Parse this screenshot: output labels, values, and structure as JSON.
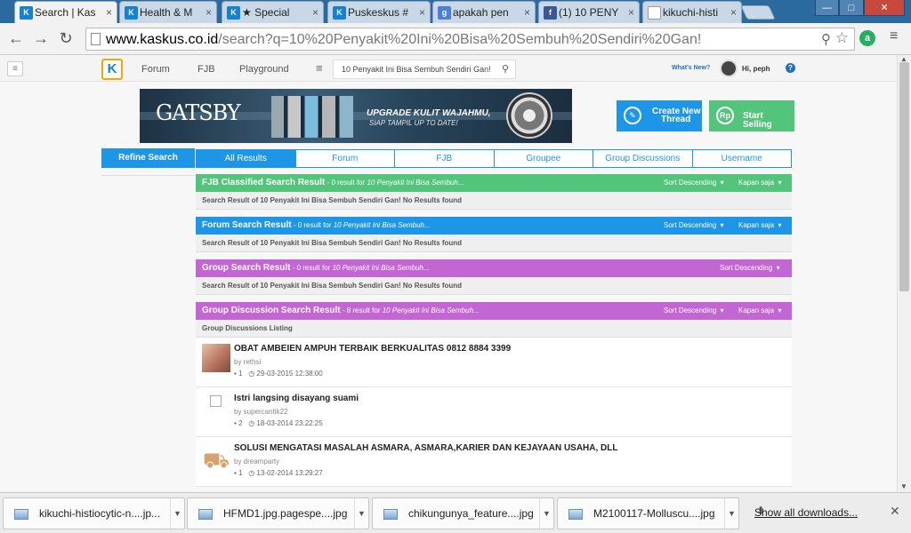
{
  "browser": {
    "tabs": [
      {
        "title": "Search | Kas",
        "favicon": "kaskus-favicon",
        "color": "#1482d0",
        "glyph": "K",
        "active": true
      },
      {
        "title": "Health & M",
        "favicon": "kaskus-favicon",
        "color": "#1482d0",
        "glyph": "K",
        "active": false
      },
      {
        "title": "★ Special",
        "favicon": "kaskus-favicon",
        "color": "#1482d0",
        "glyph": "K",
        "active": false
      },
      {
        "title": "Puskeskus #",
        "favicon": "kaskus-favicon",
        "color": "#1482d0",
        "glyph": "K",
        "active": false
      },
      {
        "title": "apakah pen",
        "favicon": "google-favicon",
        "color": "#4a7fe0",
        "glyph": "g",
        "active": false
      },
      {
        "title": "(1) 10 PENY",
        "favicon": "facebook-favicon",
        "color": "#3b5998",
        "glyph": "f",
        "active": false
      },
      {
        "title": "kikuchi-histi",
        "favicon": "page-favicon",
        "color": "#ffffff",
        "glyph": "",
        "active": false
      }
    ],
    "url_host": "www.kaskus.co.id",
    "url_path": "/search?q=10%20Penyakit%20Ini%20Bisa%20Sembuh%20Sendiri%20Gan!"
  },
  "header": {
    "logo": "K",
    "nav": [
      "Forum",
      "FJB",
      "Playground"
    ],
    "search_value": "10 Penyakit Ini Bisa Sembuh Sendiri Gan!",
    "whats_new": "What's New?",
    "greeting": "Hi, peph",
    "help": "?"
  },
  "banner": {
    "brand": "GATSBY",
    "tagline_1": "UPGRADE KULIT WAJAHMU,",
    "tagline_2": "SIAP TAMPIL UP TO DATE!"
  },
  "actions": {
    "create_thread": [
      "Create New",
      "Thread"
    ],
    "start_selling": "Start Selling"
  },
  "refine": "Refine Search",
  "search_tabs": [
    "All Results",
    "Forum",
    "FJB",
    "Groupee",
    "Group Discussions",
    "Username"
  ],
  "sections": {
    "fjb": {
      "title": "FJB Classified Search Result",
      "count": " - 0 result for ",
      "query": "10 Penyakit Ini Bisa Sembuh...",
      "sort": "Sort Descending",
      "time": "Kapan saja",
      "body": "Search Result of 10 Penyakit Ini Bisa Sembuh Sendiri Gan! No Results found",
      "color": "#52c57b"
    },
    "forum": {
      "title": "Forum Search Result",
      "count": " - 0 result for ",
      "query": "10 Penyakit Ini Bisa Sembuh...",
      "sort": "Sort Descending",
      "time": "Kapan saja",
      "body": "Search Result of 10 Penyakit Ini Bisa Sembuh Sendiri Gan! No Results found",
      "color": "#1e96e8"
    },
    "group": {
      "title": "Group Search Result",
      "count": " - 0 result for ",
      "query": "10 Penyakit Ini Bisa Sembuh...",
      "sort": "Sort Descending",
      "body": "Search Result of 10 Penyakit Ini Bisa Sembuh Sendiri Gan! No Results found",
      "color": "#c266d3"
    },
    "discussion": {
      "title": "Group Discussion Search Result",
      "count": " - 8 result for ",
      "query": "10 Penyakit Ini Bisa Sembuh...",
      "sort": "Sort Descending",
      "time": "Kapan saja",
      "listing": "Group Discussions Listing",
      "color": "#c266d3",
      "items": [
        {
          "title": "OBAT AMBEIEN AMPUH TERBAIK BERKUALITAS 0812 8884 3399",
          "by": "by rethsi",
          "replies": "1",
          "date": "29-03-2015 12:38:00"
        },
        {
          "title": "Istri langsing disayang suami",
          "by": "by supercantik22",
          "replies": "2",
          "date": "18-03-2014 23:22:25"
        },
        {
          "title": "SOLUSI MENGATASI MASALAH ASMARA, ASMARA,KARIER DAN KEJAYAAN USAHA, DLL",
          "by": "by dreamparty",
          "replies": "1",
          "date": "13-02-2014 13:29:27"
        }
      ]
    }
  },
  "downloads": {
    "files": [
      "kikuchi-histiocytic-n....jp...",
      "HFMD1.jpg.pagespe....jpg",
      "chikungunya_feature....jpg",
      "M2100117-Molluscu....jpg"
    ],
    "show_all": "Show all downloads..."
  }
}
